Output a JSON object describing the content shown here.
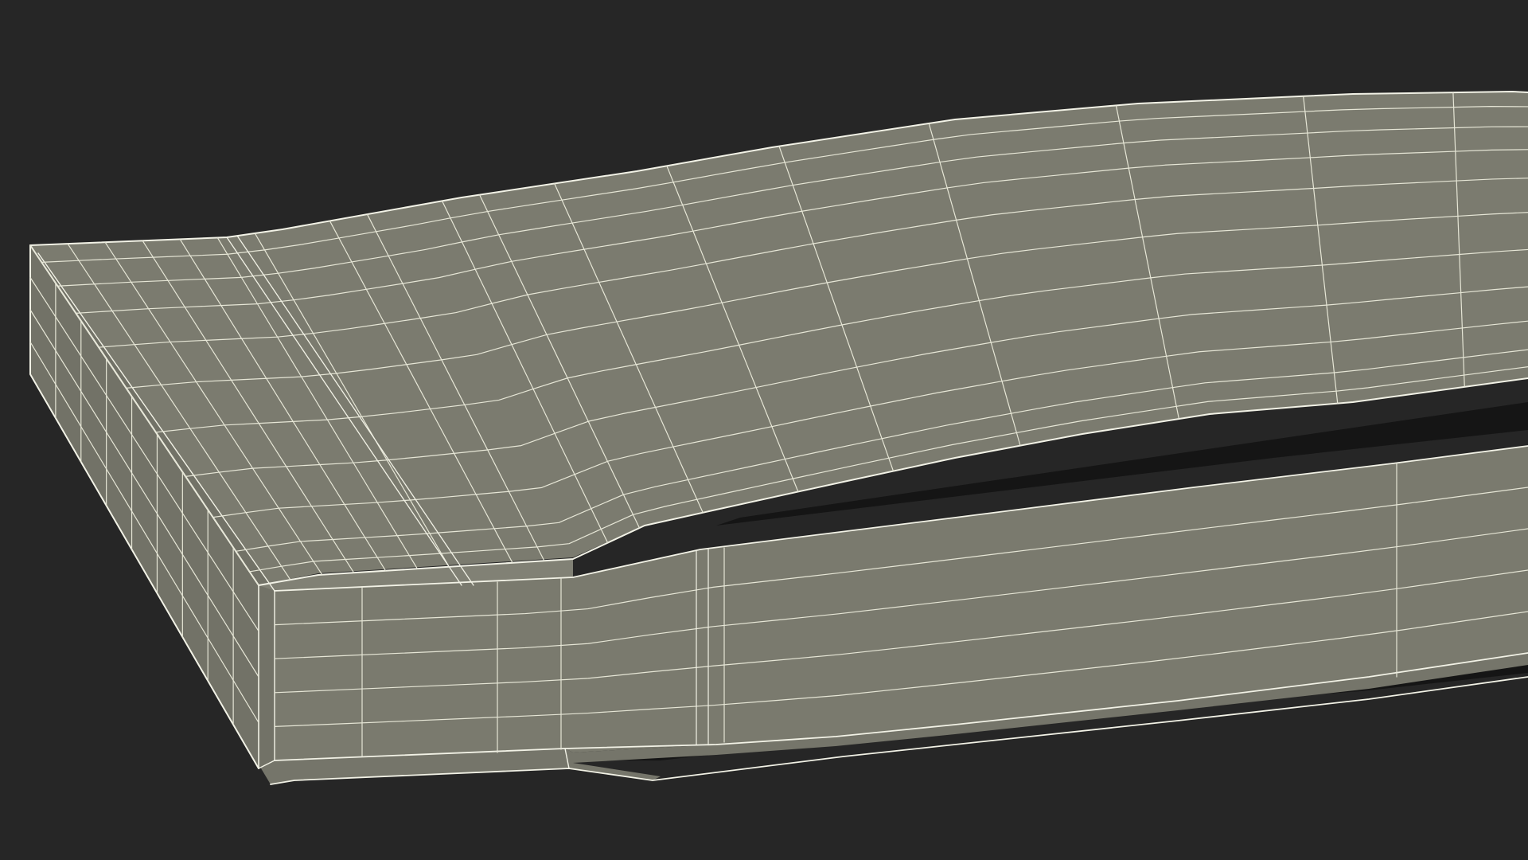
{
  "scene": {
    "subject": "wireframe-3d-model",
    "colors": {
      "background": "#262626",
      "surface": "#7a7a6e",
      "surface_dark": "#6f6f64",
      "edge_strong": "#f2f2e6",
      "edge_wire": "#e6e6d6",
      "shadow": "#111111"
    }
  }
}
